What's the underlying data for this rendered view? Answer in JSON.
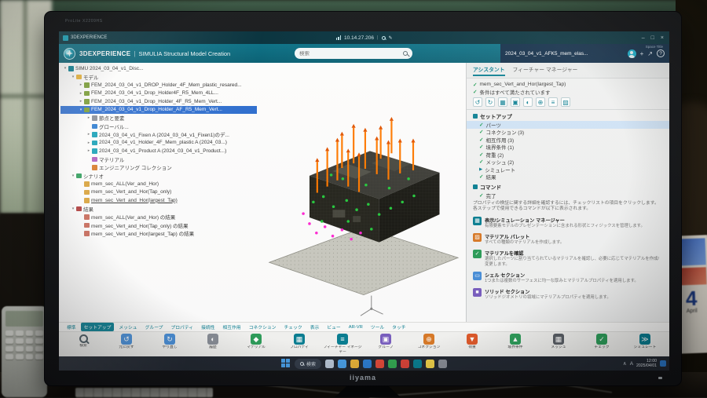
{
  "photo": {
    "monitor_model": "ProLite X2209HS",
    "monitor_brand": "iiyama",
    "poster": {
      "big_number": "4",
      "subtitle": "April"
    }
  },
  "titlebar": {
    "app_label": "3DEXPERIENCE",
    "address": "10.14.27.206",
    "minimize": "–",
    "maximize": "□",
    "close": "×"
  },
  "header": {
    "brand": "3DEXPERIENCE",
    "divider": "|",
    "app_title": "SIMULIA Structural Model Creation",
    "search_placeholder": "検索",
    "space_label": "Space Title",
    "tab_title": "2024_03_04_v1_AFK5_mem_elas...",
    "plus": "+",
    "share": "↗",
    "help": "?"
  },
  "tree": {
    "items": [
      {
        "level": 0,
        "icon": "sim",
        "arrow": "▾",
        "label": "SIMU 2024_03_04_v1_Disc..."
      },
      {
        "level": 1,
        "icon": "folder",
        "arrow": "▾",
        "label": "モデル"
      },
      {
        "level": 2,
        "icon": "fem",
        "arrow": "▸",
        "label": "FEM_2024_03_04_v1_DROP_Holder_4F_Mem_plastic_resared..."
      },
      {
        "level": 2,
        "icon": "fem",
        "arrow": "▸",
        "label": "FEM_2024_03_04_v1_Drop_Holder4F_R5_Mem_4LL..."
      },
      {
        "level": 2,
        "icon": "fem",
        "arrow": "▸",
        "label": "FEM_2024_03_04_v1_Drop_Holder_4F_R5_Mem_Vert..."
      },
      {
        "level": 2,
        "icon": "fem",
        "arrow": "▾",
        "selected": true,
        "label": "FEM_2024_03_04_v1_Drop_Holder_AF_R5_Mem_Vert..."
      },
      {
        "level": 3,
        "icon": "mesh",
        "arrow": "▸",
        "label": "節点と要素"
      },
      {
        "level": 3,
        "icon": "globe",
        "arrow": "",
        "label": "グローバル..."
      },
      {
        "level": 3,
        "icon": "part",
        "arrow": "▸",
        "label": "2024_03_04_v1_Fixen A (2024_03_04_v1_Fixen1)のデ..."
      },
      {
        "level": 3,
        "icon": "part",
        "arrow": "▸",
        "label": "2024_03_04_v1_Holder_4F_Mem_plastic A (2024_03...)"
      },
      {
        "level": 3,
        "icon": "part",
        "arrow": "▸",
        "label": "2024_03_04_v1_Product A (2024_03_04_v1_Product...)"
      },
      {
        "level": 3,
        "icon": "material",
        "arrow": "",
        "label": "マテリアル"
      },
      {
        "level": 3,
        "icon": "collection",
        "arrow": "",
        "label": "エンジニアリング コレクション"
      },
      {
        "level": 1,
        "icon": "scenario",
        "arrow": "▾",
        "label": "シナリオ"
      },
      {
        "level": 2,
        "icon": "case",
        "arrow": "",
        "label": "mem_sec_ALL(Ver_and_Hor)"
      },
      {
        "level": 2,
        "icon": "case",
        "arrow": "",
        "label": "mem_sec_Vert_and_Hor(Tap_only)"
      },
      {
        "level": 2,
        "icon": "case",
        "arrow": "",
        "underline": true,
        "label": "mem_sec_Vert_and_Hor(largest_Tap)"
      },
      {
        "level": 1,
        "icon": "result",
        "arrow": "▾",
        "label": "結果"
      },
      {
        "level": 2,
        "icon": "resultitem",
        "arrow": "",
        "label": "mem_sec_ALL(Ver_and_Hor) の結果"
      },
      {
        "level": 2,
        "icon": "resultitem",
        "arrow": "",
        "label": "mem_sec_Vert_and_Hor(Tap_only) の結果"
      },
      {
        "level": 2,
        "icon": "resultitem",
        "arrow": "",
        "label": "mem_sec_Vert_and_Hor(largest_Tap) の結果"
      }
    ]
  },
  "assistant": {
    "tabs": [
      {
        "label": "アシスタント"
      },
      {
        "label": "フィーチャー マネージャー"
      }
    ],
    "status": [
      {
        "label": "mem_sec_Vert_and_Hor(largest_Tap)"
      },
      {
        "label": "条件はすべて満たされています"
      }
    ],
    "toolstrip": [
      "↺",
      "↻",
      "▦",
      "▣",
      "◐",
      "⊕",
      "≡",
      "▨"
    ],
    "setup": {
      "header": "セットアップ",
      "items": [
        {
          "label": "パーツ",
          "check": true,
          "selected": true
        },
        {
          "label": "コネクション (3)",
          "check": true
        },
        {
          "label": "相互作用 (3)",
          "check": true
        },
        {
          "label": "境界条件 (1)",
          "check": true
        },
        {
          "label": "荷重 (2)",
          "check": true
        },
        {
          "label": "メッシュ (2)",
          "check": true
        }
      ],
      "simulate_label": "シミュレート",
      "result_label": "結果"
    },
    "commands": {
      "header": "コマンド",
      "done_label": "完了",
      "note": "プロパティの検証に関する詳細を確認するには、チェックリストの項目をクリックします。各ステップで使用できるコマンドが以下に表示されます。",
      "tools": [
        {
          "name": "表示/シミュレーション マネージャー",
          "desc": "有限要素モデルのプレゼンテーションに含まれる形状とフィジックスを管理します。",
          "glyph": "▦",
          "color": "#0a7f93"
        },
        {
          "name": "マテリアル パレット",
          "desc": "すべての種類のマテリアルを作成します。",
          "glyph": "▨",
          "color": "#d97b29"
        },
        {
          "name": "マテリアルを確認",
          "desc": "選択したパーツに割り当てられているマテリアルを確認し、必要に応じてマテリアルを作成/変更します。",
          "glyph": "✓",
          "color": "#2e9e5b"
        },
        {
          "name": "シェル セクション",
          "desc": "1つまたは複数のサーフェスに均一な厚みとマテリアルプロパティを適用します。",
          "glyph": "▭",
          "color": "#4a90d9"
        },
        {
          "name": "ソリッド セクション",
          "desc": "ソリッドジオメトリの領域にマテリアルプロパティを適用します。",
          "glyph": "■",
          "color": "#7a5fc0"
        }
      ]
    }
  },
  "ribbon": {
    "tabs": [
      "標準",
      "セットアップ",
      "メッシュ",
      "グループ",
      "プロパティ",
      "接続性",
      "相互作用",
      "コネクション",
      "チェック",
      "表示",
      "ビュー",
      "AR-VR",
      "ツール",
      "タッチ"
    ],
    "active_tab": "セットアップ",
    "tools": [
      {
        "label": "検索",
        "type": "magnifier"
      },
      {
        "label": "元に戻す",
        "glyph": "↺",
        "color": "#4a90d9"
      },
      {
        "label": "やり直し",
        "glyph": "↻",
        "color": "#4a90d9"
      },
      {
        "label": "履歴",
        "glyph": "◐",
        "color": "#8a8f98"
      },
      {
        "label": "マテリアル",
        "glyph": "◆",
        "color": "#2e9e5b"
      },
      {
        "label": "プロパティ",
        "glyph": "▦",
        "color": "#0a7f93"
      },
      {
        "label": "フィーチャー マネージャー",
        "glyph": "≡",
        "color": "#0a7f93"
      },
      {
        "label": "グループ",
        "glyph": "▣",
        "color": "#7a5fc0"
      },
      {
        "label": "コネクション",
        "glyph": "⊕",
        "color": "#d97b29"
      },
      {
        "label": "荷重",
        "glyph": "▼",
        "color": "#e05a2b"
      },
      {
        "label": "境界条件",
        "glyph": "▲",
        "color": "#2e9e5b"
      },
      {
        "label": "メッシュ",
        "glyph": "▦",
        "color": "#5a5f66"
      },
      {
        "label": "チェック",
        "glyph": "✓",
        "color": "#2e9e5b"
      },
      {
        "label": "シミュレート",
        "glyph": "≫",
        "color": "#0a7f93"
      }
    ]
  },
  "taskbar": {
    "search_label": "検索",
    "icons": [
      {
        "name": "task-view-icon",
        "color": "#b9c7d8"
      },
      {
        "name": "widgets-icon",
        "color": "#4aa0e8"
      },
      {
        "name": "file-explorer-icon",
        "color": "#e8b33a"
      },
      {
        "name": "edge-icon",
        "color": "#2d7dd2"
      },
      {
        "name": "chrome-icon",
        "color": "#e04a3a"
      },
      {
        "name": "store-icon",
        "color": "#34a853"
      },
      {
        "name": "office-icon",
        "color": "#d9443a"
      },
      {
        "name": "3dexperience-icon",
        "color": "#0a7f93"
      },
      {
        "name": "notes-icon",
        "color": "#f0d24a"
      },
      {
        "name": "settings-icon",
        "color": "#8a8f98"
      }
    ],
    "tray": [
      "∧",
      "A"
    ],
    "time": "12:00",
    "date": "2025/04/01"
  },
  "viewport": {
    "load_color": "#ff7a00",
    "load_tip_color": "#e25400",
    "node_ok_color": "#27c93f",
    "node_pin_color": "#ff2ad4",
    "base_color": "#c9c9c0",
    "mesh_dark": "#23231f"
  }
}
